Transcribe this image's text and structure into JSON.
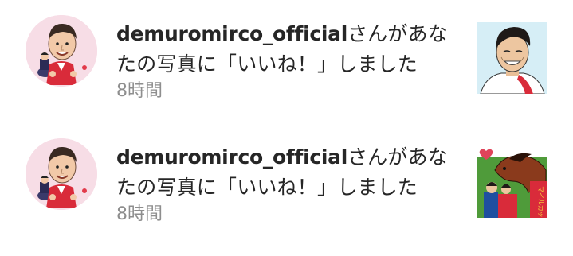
{
  "notifications": [
    {
      "username": "demuromirco_official",
      "message": "さんがあなたの写真に「いいね！」しました",
      "time": "8時間",
      "avatar_icon": "profile-avatar-caricature",
      "thumbnail_icon": "jockey-portrait-thumbnail"
    },
    {
      "username": "demuromirco_official",
      "message": "さんがあなたの写真に「いいね！」しました",
      "time": "8時間",
      "avatar_icon": "profile-avatar-caricature",
      "thumbnail_icon": "horse-and-jockey-thumbnail",
      "thumbnail_text": "マイルカップ"
    }
  ],
  "colors": {
    "text": "#262626",
    "secondary_text": "#8e8e8e",
    "avatar_background": "#f7dde6",
    "background": "#ffffff"
  }
}
